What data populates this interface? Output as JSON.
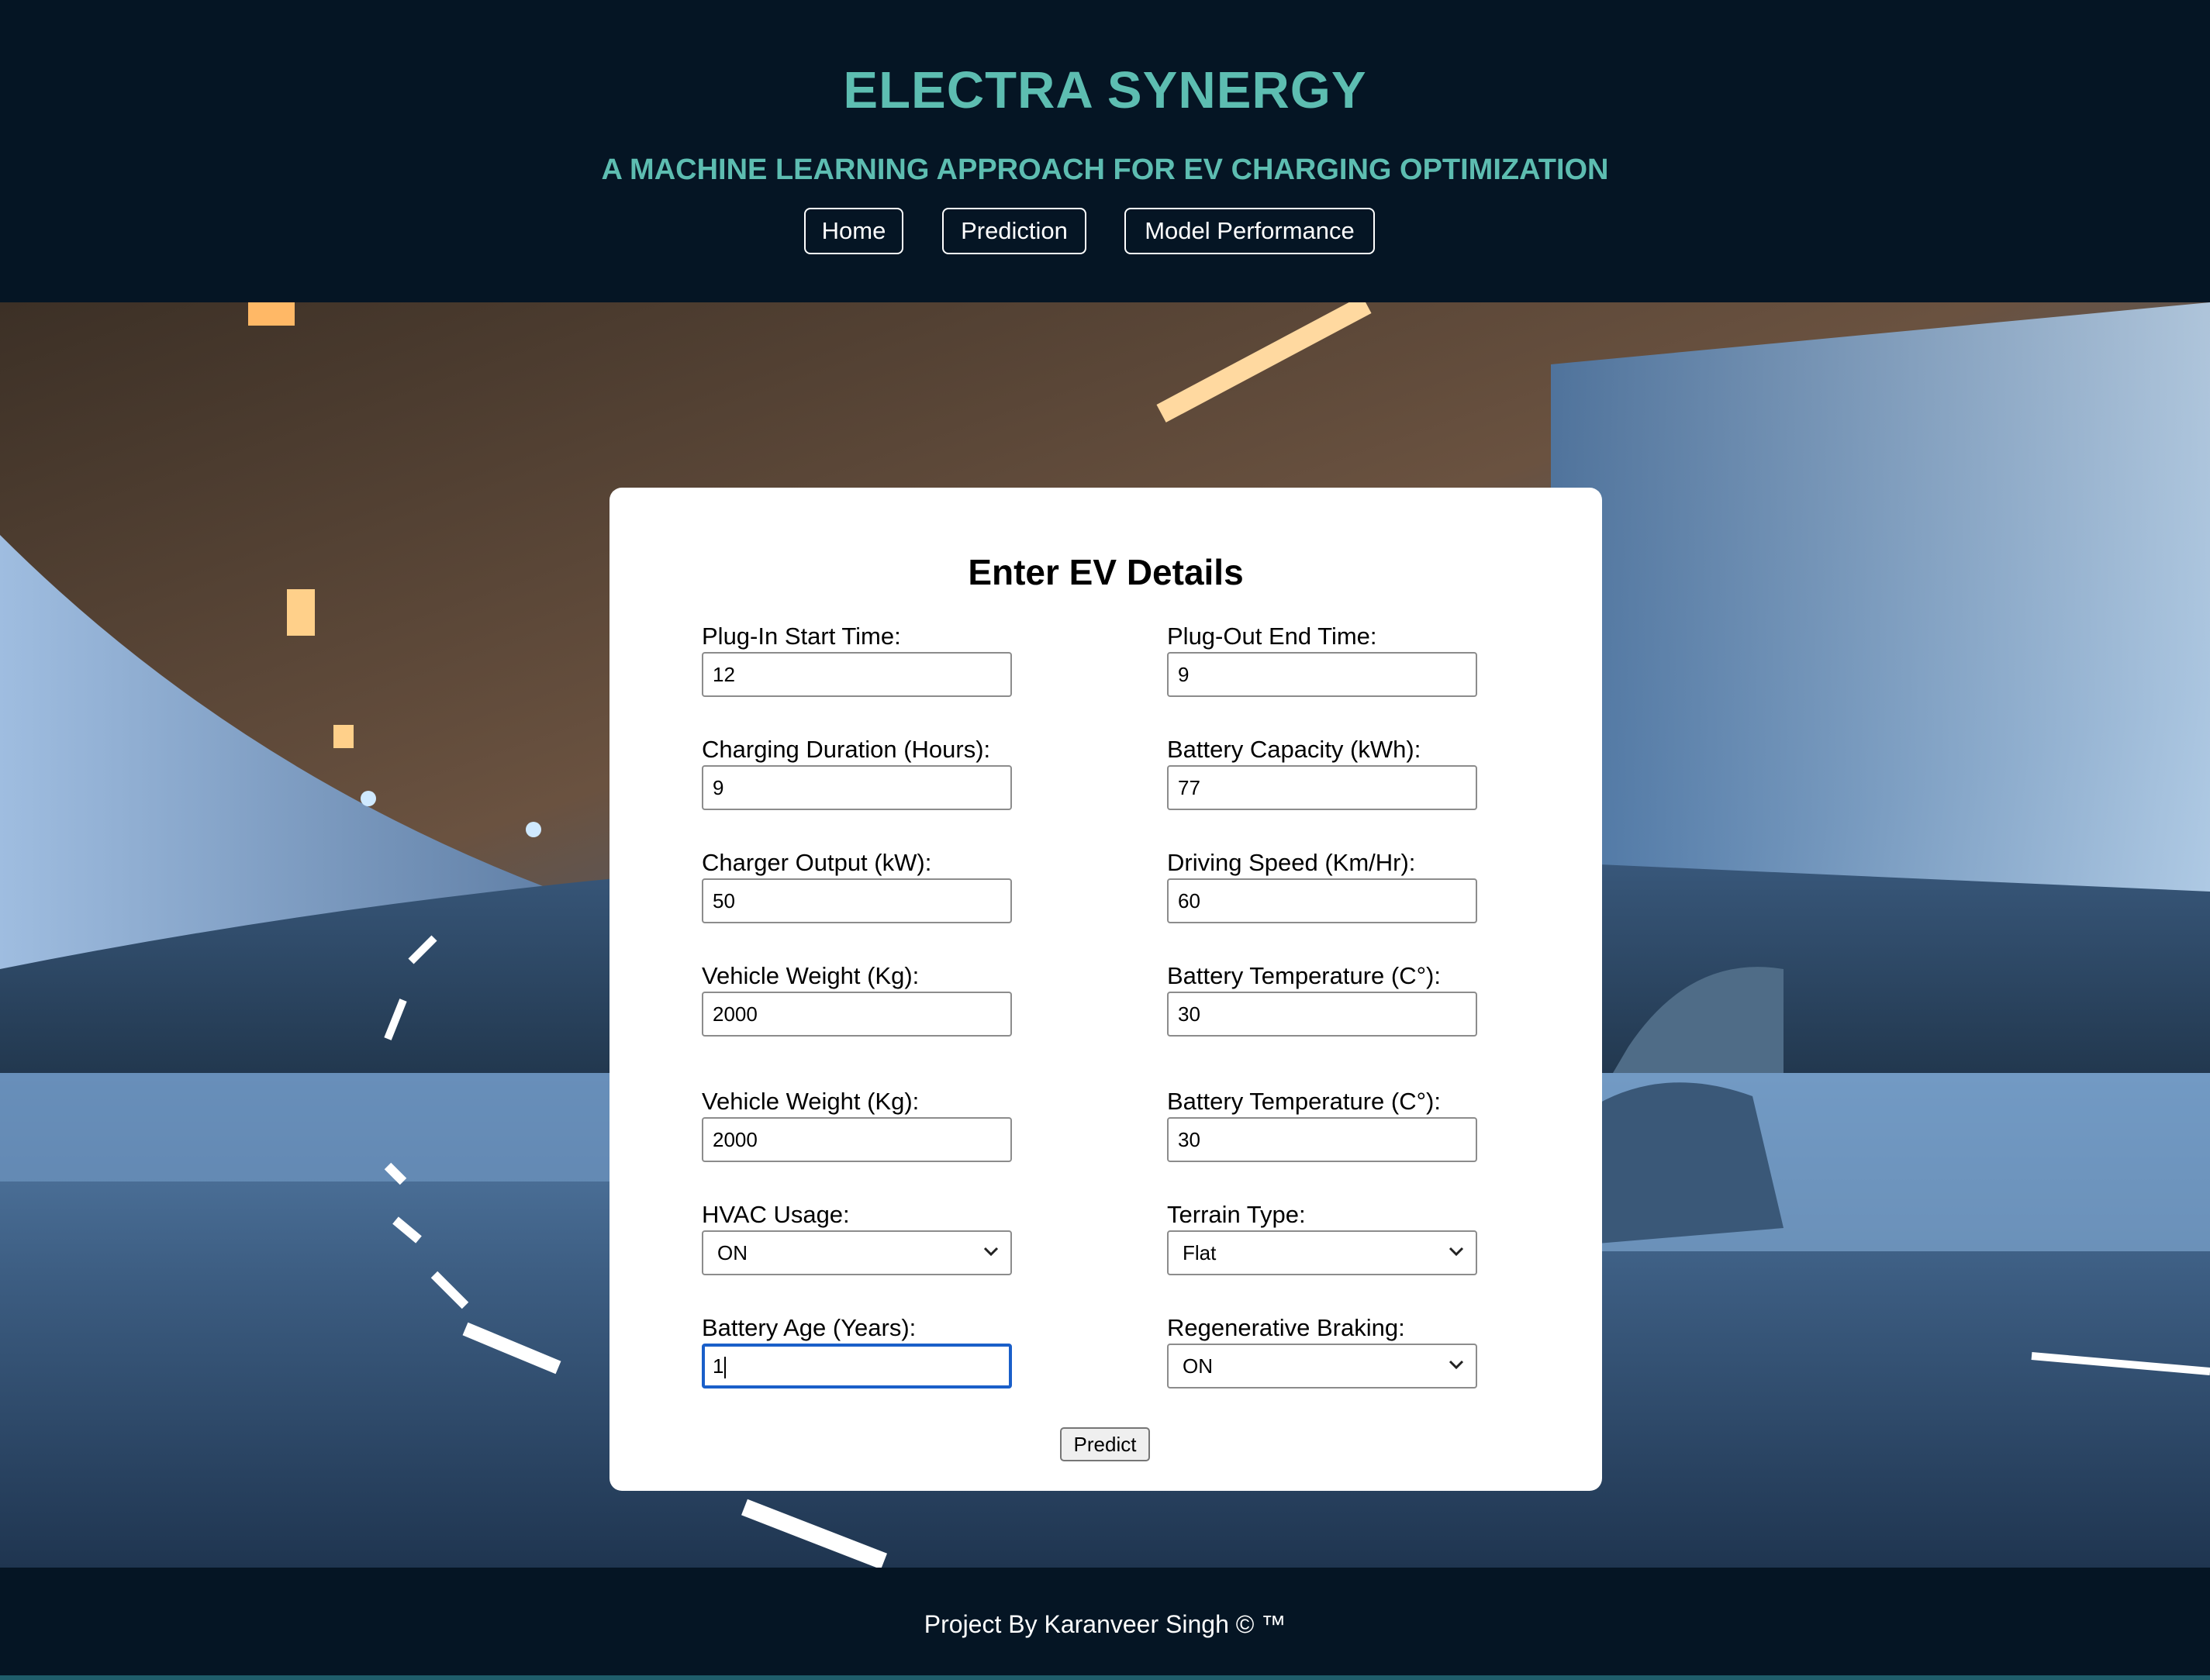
{
  "header": {
    "title": "ELECTRA SYNERGY",
    "subtitle": "A MACHINE LEARNING APPROACH FOR EV CHARGING OPTIMIZATION",
    "nav": {
      "home": "Home",
      "prediction": "Prediction",
      "model_performance": "Model Performance"
    }
  },
  "form": {
    "title": "Enter EV Details",
    "fields": {
      "plug_in_start": {
        "label": "Plug-In Start Time:",
        "value": "12"
      },
      "plug_out_end": {
        "label": "Plug-Out End Time:",
        "value": "9"
      },
      "charging_duration": {
        "label": "Charging Duration (Hours):",
        "value": "9"
      },
      "battery_capacity": {
        "label": "Battery Capacity (kWh):",
        "value": "77"
      },
      "charger_output": {
        "label": "Charger Output (kW):",
        "value": "50"
      },
      "driving_speed": {
        "label": "Driving Speed (Km/Hr):",
        "value": "60"
      },
      "vehicle_weight": {
        "label": "Vehicle Weight (Kg):",
        "value": "2000"
      },
      "battery_temperature": {
        "label": "Battery Temperature (C°):",
        "value": "30"
      },
      "vehicle_weight_2": {
        "label": "Vehicle Weight (Kg):",
        "value": "2000"
      },
      "battery_temperature_2": {
        "label": "Battery Temperature (C°):",
        "value": "30"
      },
      "hvac_usage": {
        "label": "HVAC Usage:",
        "value": "ON"
      },
      "terrain_type": {
        "label": "Terrain Type:",
        "value": "Flat"
      },
      "battery_age": {
        "label": "Battery Age (Years):",
        "value": "1"
      },
      "regenerative_braking": {
        "label": "Regenerative Braking:",
        "value": "ON"
      }
    },
    "predict_label": "Predict"
  },
  "footer": {
    "text": "Project By Karanveer Singh © ™"
  },
  "colors": {
    "header_bg": "#051524",
    "accent": "#5dbdb1",
    "focus": "#1a5fc9"
  },
  "icons": {
    "select_arrow": "chevron-down-icon"
  }
}
